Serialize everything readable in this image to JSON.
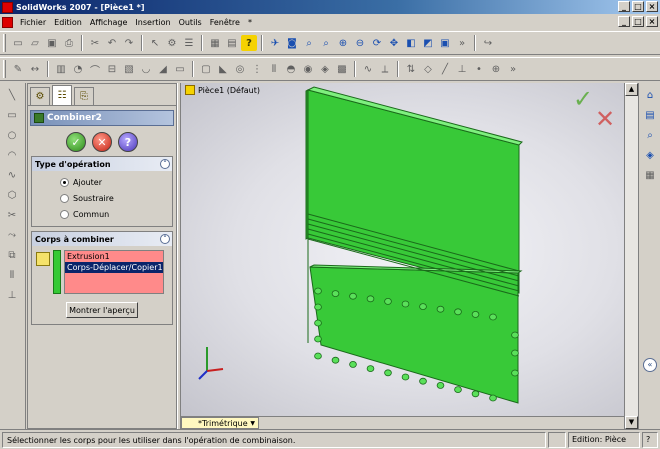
{
  "window": {
    "title": "SolidWorks 2007 - [Pièce1 *]",
    "buttons": [
      "_",
      "□",
      "×"
    ]
  },
  "menu": {
    "items": [
      "Fichier",
      "Edition",
      "Affichage",
      "Insertion",
      "Outils",
      "Fenêtre",
      "*"
    ]
  },
  "property_manager": {
    "title": "Combiner2",
    "operation_group": {
      "title": "Type d'opération",
      "options": [
        {
          "label": "Ajouter",
          "checked": true
        },
        {
          "label": "Soustraire",
          "checked": false
        },
        {
          "label": "Commun",
          "checked": false
        }
      ]
    },
    "bodies_group": {
      "title": "Corps à combiner",
      "items": [
        {
          "label": "Extrusion1",
          "selected": false
        },
        {
          "label": "Corps-Déplacer/Copier1",
          "selected": true
        }
      ],
      "preview_button": "Montrer l'aperçu"
    }
  },
  "viewport": {
    "tree_node": "Pièce1 (Défaut)",
    "view_tab": "*Trimétrique"
  },
  "statusbar": {
    "message": "Sélectionner les corps pour les utiliser dans l'opération de combinaison.",
    "mode": "Edition: Pièce",
    "help": "?"
  },
  "colors": {
    "model_face": "#38c938",
    "model_edge": "#1a6a1a",
    "selection_list": "#ff8a8a"
  }
}
